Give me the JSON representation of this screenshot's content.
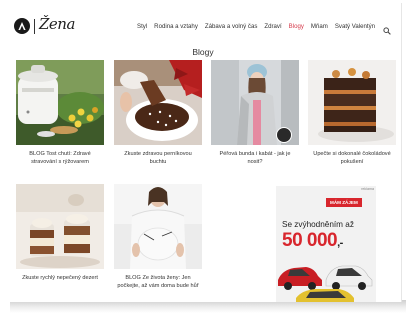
{
  "header": {
    "logo_text": "Žena",
    "nav": [
      {
        "label": "Styl",
        "active": false
      },
      {
        "label": "Rodina a vztahy",
        "active": false
      },
      {
        "label": "Zábava a volný čas",
        "active": false
      },
      {
        "label": "Zdraví",
        "active": false
      },
      {
        "label": "Blogy",
        "active": true
      },
      {
        "label": "Mňam",
        "active": false
      },
      {
        "label": "Svatý Valentýn",
        "active": false
      }
    ],
    "search_icon": "search-icon",
    "active_color": "#d63a4b"
  },
  "page_title": "Blogy",
  "cards": [
    {
      "caption_lines": [
        "BLOG Tost chutí: Zdravé",
        "stravování s rýžovarem"
      ]
    },
    {
      "caption_lines": [
        "Zkuste zdravou perníkovou",
        "buchtu"
      ]
    },
    {
      "caption_lines": [
        "Péřová bunda i kabát - jak je",
        "nosit?"
      ]
    },
    {
      "caption_lines": [
        "Upečte si dokonalé čokoládové",
        "pokušení"
      ]
    },
    {
      "caption_lines": [
        "Zkuste rychlý nepečený dezert"
      ]
    },
    {
      "caption_lines": [
        "BLOG Ze života ženy: Jen",
        "počkejte, až vám doma bude hůř"
      ]
    }
  ],
  "ad": {
    "tag": "reklama",
    "badge": "MÁM ZÁJEM",
    "line1": "Se zvýhodněním až",
    "big_number": "50 000",
    "big_suffix": ",-",
    "brand_color": "#d8262d"
  }
}
